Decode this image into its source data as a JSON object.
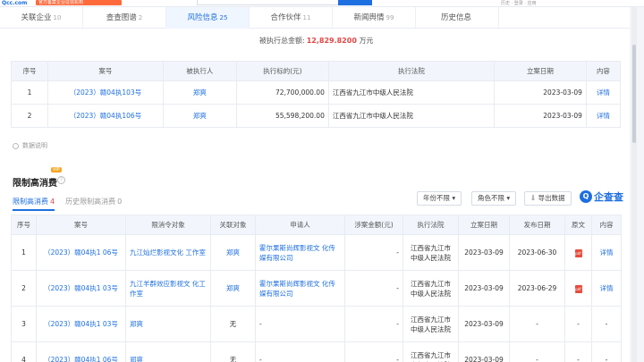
{
  "top": {
    "logo": "Qcc.com",
    "tag": "官方备案企业征信机构",
    "right": "历史 · 登录 · 应用"
  },
  "tabs": [
    {
      "label": "关联企业",
      "count": "10"
    },
    {
      "label": "查查图谱",
      "count": "2"
    },
    {
      "label": "风险信息",
      "count": "25"
    },
    {
      "label": "合作伙伴",
      "count": "11"
    },
    {
      "label": "新闻舆情",
      "count": "99"
    },
    {
      "label": "历史信息",
      "count": ""
    }
  ],
  "executed": {
    "total_label": "被执行总金额:",
    "total_value": "12,829.8200",
    "total_unit": "万元",
    "headers": [
      "序号",
      "案号",
      "被执行人",
      "执行标的(元)",
      "执行法院",
      "立案日期",
      "内容"
    ],
    "rows": [
      {
        "no": "1",
        "case": "（2023）赣04执103号",
        "person": "郑爽",
        "amount": "72,700,000.00",
        "court": "江西省九江市中级人民法院",
        "date": "2023-03-09",
        "action": "详情"
      },
      {
        "no": "2",
        "case": "（2023）赣04执106号",
        "person": "郑爽",
        "amount": "55,598,200.00",
        "court": "江西省九江市中级人民法院",
        "date": "2023-03-09",
        "action": "详情"
      }
    ]
  },
  "notes_label": "数据说明",
  "restrict": {
    "title": "限制高消费",
    "vip": "VIP",
    "help": "?",
    "subtabs": [
      {
        "label": "限制高消费",
        "count": "4"
      },
      {
        "label": "历史限制高消费",
        "count": "0"
      }
    ],
    "filters": {
      "year": "年份不限 ▾",
      "role": "角色不限 ▾",
      "export": "导出数据"
    },
    "brand": "企查查",
    "brand_icon": "Q",
    "headers": [
      "序号",
      "案号",
      "限消令对象",
      "关联对象",
      "申请人",
      "涉案金额(元)",
      "执行法院",
      "立案日期",
      "发布日期",
      "原文",
      "内容"
    ],
    "rows": [
      {
        "no": "1",
        "case": "（2023）赣04执1 06号",
        "target": "九江灿烂影视文化 工作室",
        "related": "郑爽",
        "applicant": "霍尔果斯尚辉影视文 化传媒有限公司",
        "amount": "-",
        "court": "江西省九江市 中级人民法院",
        "date": "2023-03-09",
        "pub": "2023-06-30",
        "doc": "pdf",
        "action": "详情"
      },
      {
        "no": "2",
        "case": "（2023）赣04执1 03号",
        "target": "九江羊群效应影视文 化工作室",
        "related": "郑爽",
        "applicant": "霍尔果斯尚辉影视文 化传媒有限公司",
        "amount": "-",
        "court": "江西省九江市 中级人民法院",
        "date": "2023-03-09",
        "pub": "2023-06-29",
        "doc": "pdf",
        "action": "详情"
      },
      {
        "no": "3",
        "case": "（2023）赣04执1 03号",
        "target": "郑爽",
        "related": "无",
        "applicant": "-",
        "amount": "-",
        "court": "江西省九江市 中级人民法院",
        "date": "2023-03-09",
        "pub": "-",
        "doc": "-",
        "action": "-"
      },
      {
        "no": "4",
        "case": "（2023）赣04执1 06号",
        "target": "郑爽",
        "related": "无",
        "applicant": "-",
        "amount": "-",
        "court": "江西省九江市 中级人民法院",
        "date": "2023-03-09",
        "pub": "-",
        "doc": "-",
        "action": "-"
      }
    ]
  }
}
